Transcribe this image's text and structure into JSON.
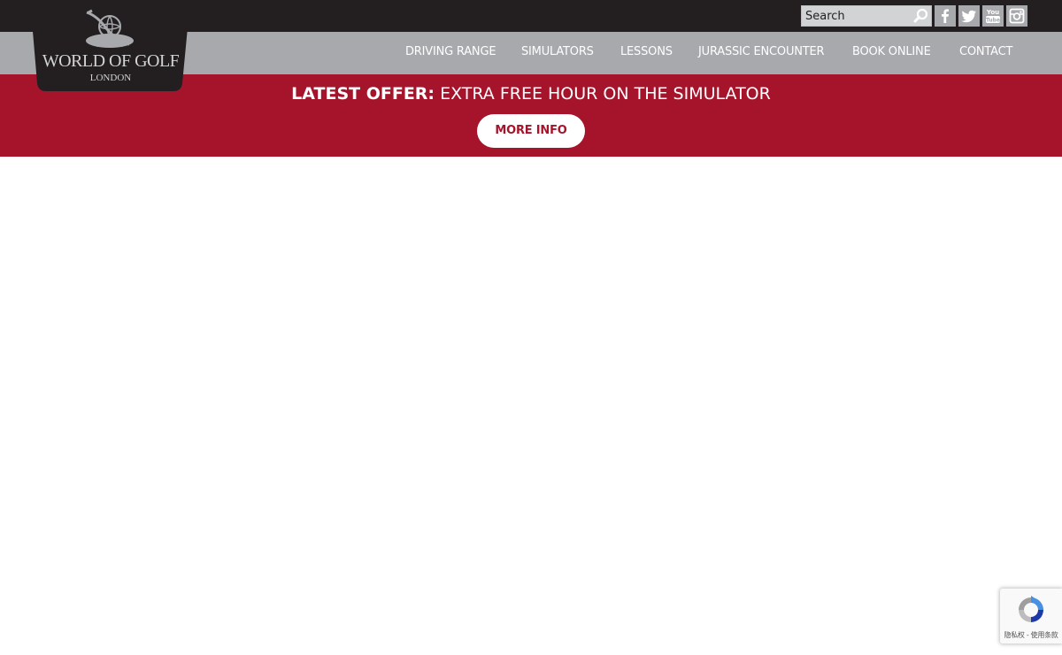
{
  "brand": {
    "logo_line1": "WORLD OF GOLF",
    "logo_line2": "LONDON",
    "colors": {
      "dark": "#231f20",
      "nav_grey": "#a7a9ac",
      "red": "#a6142c",
      "white": "#ffffff"
    }
  },
  "search": {
    "placeholder": "Search",
    "icon": "search-icon"
  },
  "social": [
    {
      "name": "facebook",
      "icon": "facebook-icon"
    },
    {
      "name": "twitter",
      "icon": "twitter-icon"
    },
    {
      "name": "youtube",
      "icon": "youtube-icon"
    },
    {
      "name": "instagram",
      "icon": "instagram-icon"
    }
  ],
  "nav": {
    "items": [
      {
        "label": "DRIVING RANGE"
      },
      {
        "label": "SIMULATORS"
      },
      {
        "label": "LESSONS"
      },
      {
        "label": "JURASSIC ENCOUNTER"
      },
      {
        "label": "BOOK ONLINE"
      },
      {
        "label": "CONTACT"
      }
    ]
  },
  "offer": {
    "label": "LATEST OFFER:",
    "text": "EXTRA FREE HOUR ON THE SIMULATOR",
    "button_label": "MORE INFO"
  },
  "recaptcha": {
    "text": "隐私权 - 使用条款",
    "icon": "recaptcha-icon"
  }
}
